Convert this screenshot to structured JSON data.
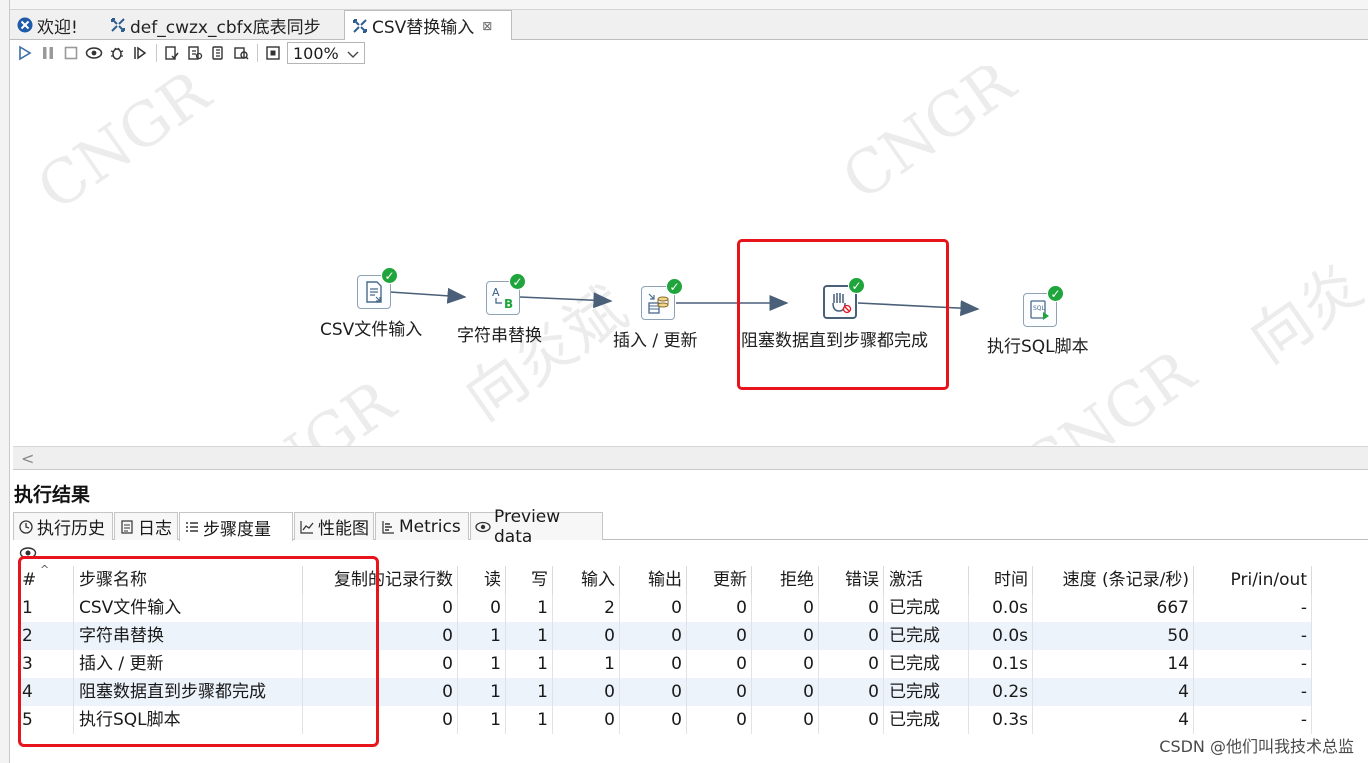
{
  "tabs": [
    {
      "label": "欢迎!",
      "icon": "welcome-icon"
    },
    {
      "label": "def_cwzx_cbfx底表同步",
      "icon": "transformation-icon"
    },
    {
      "label": "CSV替换输入",
      "icon": "transformation-icon",
      "close": "⊠"
    }
  ],
  "toolbar": {
    "zoom": "100%"
  },
  "steps": [
    {
      "label": "CSV文件输入",
      "icon": "csv-file-input-icon"
    },
    {
      "label": "字符串替换",
      "icon": "string-replace-icon"
    },
    {
      "label": "插入 / 更新",
      "icon": "insert-update-icon"
    },
    {
      "label": "阻塞数据直到步骤都完成",
      "icon": "block-until-steps-finish-icon"
    },
    {
      "label": "执行SQL脚本",
      "icon": "execute-sql-script-icon"
    }
  ],
  "watermarks": [
    "CNGR",
    "CNGR",
    "CNGR",
    "CNGR",
    "CNGR",
    "向炎斌",
    "向炎斌",
    "向炎斌",
    "CNGR",
    "向炎斌",
    "向炎"
  ],
  "results": {
    "title": "执行结果",
    "tabs": [
      "执行历史",
      "日志",
      "步骤度量",
      "性能图",
      "Metrics",
      "Preview data"
    ],
    "columns": [
      "#",
      "步骤名称",
      "复制的记录行数",
      "读",
      "写",
      "输入",
      "输出",
      "更新",
      "拒绝",
      "错误",
      "激活",
      "时间",
      "速度 (条记录/秒)",
      "Pri/in/out"
    ],
    "rows": [
      [
        "1",
        "CSV文件输入",
        "0",
        "0",
        "1",
        "2",
        "0",
        "0",
        "0",
        "0",
        "已完成",
        "0.0s",
        "667",
        "-"
      ],
      [
        "2",
        "字符串替换",
        "0",
        "1",
        "1",
        "0",
        "0",
        "0",
        "0",
        "0",
        "已完成",
        "0.0s",
        "50",
        "-"
      ],
      [
        "3",
        "插入 / 更新",
        "0",
        "1",
        "1",
        "1",
        "0",
        "0",
        "0",
        "0",
        "已完成",
        "0.1s",
        "14",
        "-"
      ],
      [
        "4",
        "阻塞数据直到步骤都完成",
        "0",
        "1",
        "1",
        "0",
        "0",
        "0",
        "0",
        "0",
        "已完成",
        "0.2s",
        "4",
        "-"
      ],
      [
        "5",
        "执行SQL脚本",
        "0",
        "1",
        "1",
        "0",
        "0",
        "0",
        "0",
        "0",
        "已完成",
        "0.3s",
        "4",
        "-"
      ]
    ]
  },
  "credit": "CSDN @他们叫我技术总监",
  "colors": {
    "highlight": "#e8141b",
    "check": "#1fa53b",
    "hop": "#4a5f78"
  }
}
